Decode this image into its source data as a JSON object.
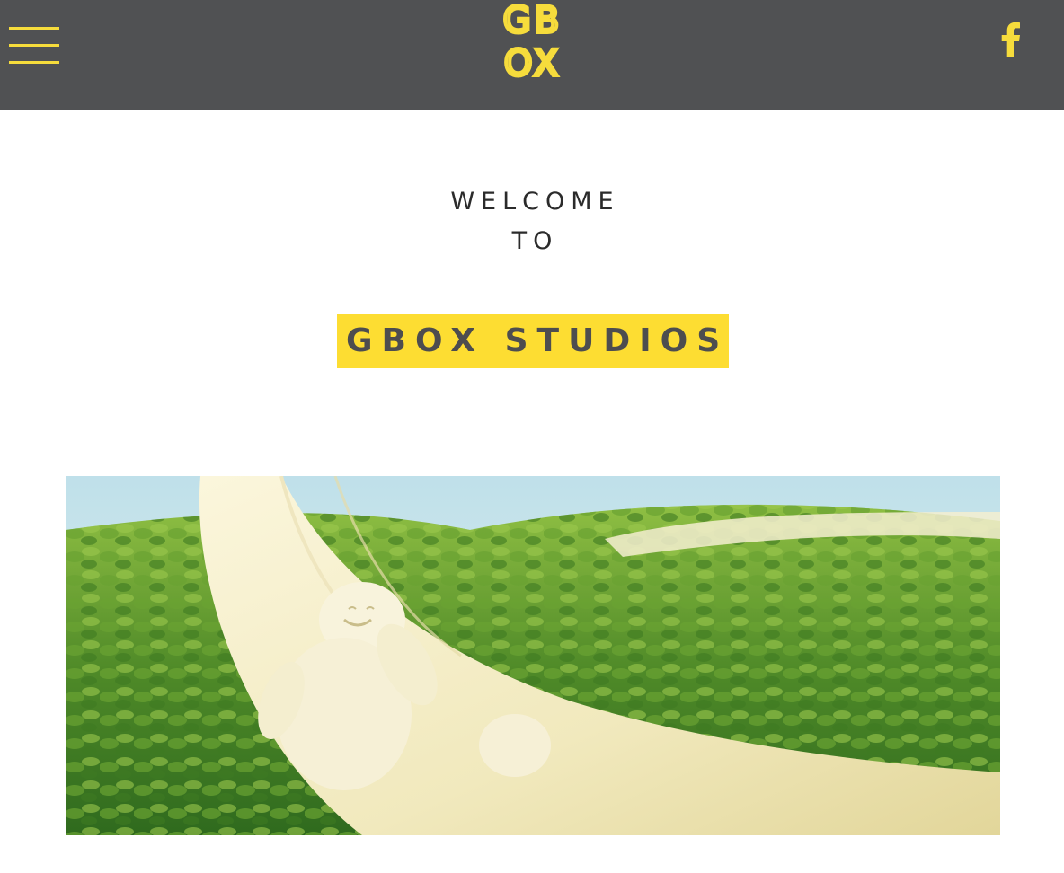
{
  "header": {
    "logo_text_top": "GB",
    "logo_text_bottom": "OX",
    "menu_icon": "hamburger-menu-icon",
    "social_icon": "facebook-icon",
    "social_glyph": "f",
    "accent_color": "#f6dc3c",
    "background_color": "#505153"
  },
  "intro": {
    "line1": "WELCOME",
    "line2": "TO",
    "title": "GBOX STUDIOS",
    "title_highlight_color": "#fddd32"
  },
  "hero": {
    "image_subject": "white mushroom figure resting in a banana-peel hammock over green tea fields"
  }
}
